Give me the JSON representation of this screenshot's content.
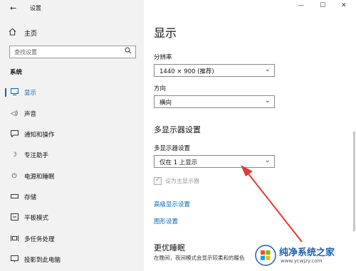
{
  "window": {
    "title": "设置"
  },
  "sidebar": {
    "home": "主页",
    "search_placeholder": "查找设置",
    "group": "系统",
    "items": [
      {
        "label": "显示",
        "icon": "monitor-icon",
        "active": true
      },
      {
        "label": "声音",
        "icon": "speaker-icon"
      },
      {
        "label": "通知和操作",
        "icon": "notification-icon"
      },
      {
        "label": "专注助手",
        "icon": "moon-icon"
      },
      {
        "label": "电源和睡眠",
        "icon": "power-icon"
      },
      {
        "label": "存储",
        "icon": "storage-icon"
      },
      {
        "label": "平板模式",
        "icon": "tablet-icon"
      },
      {
        "label": "多任务处理",
        "icon": "multitask-icon"
      },
      {
        "label": "投影到此电脑",
        "icon": "project-icon"
      }
    ]
  },
  "main": {
    "title": "显示",
    "resolution_label": "分辨率",
    "resolution_value": "1440 × 900 (推荐)",
    "orientation_label": "方向",
    "orientation_value": "横向",
    "multi_heading": "多显示器设置",
    "multi_label": "多显示器设置",
    "multi_value": "仅在 1 上显示",
    "main_display_checkbox": "设为主显示器",
    "link_advanced": "高级显示设置",
    "link_graphics": "图形设置",
    "sleep_heading": "更优睡眠",
    "sleep_note": "在晚间，夜间模式会显示较柔和的暖色"
  },
  "watermark": {
    "title": "纯净系统之家",
    "url": "www.ycwjzy.com"
  },
  "colors": {
    "accent": "#0067c0",
    "arrow": "#e53935"
  }
}
